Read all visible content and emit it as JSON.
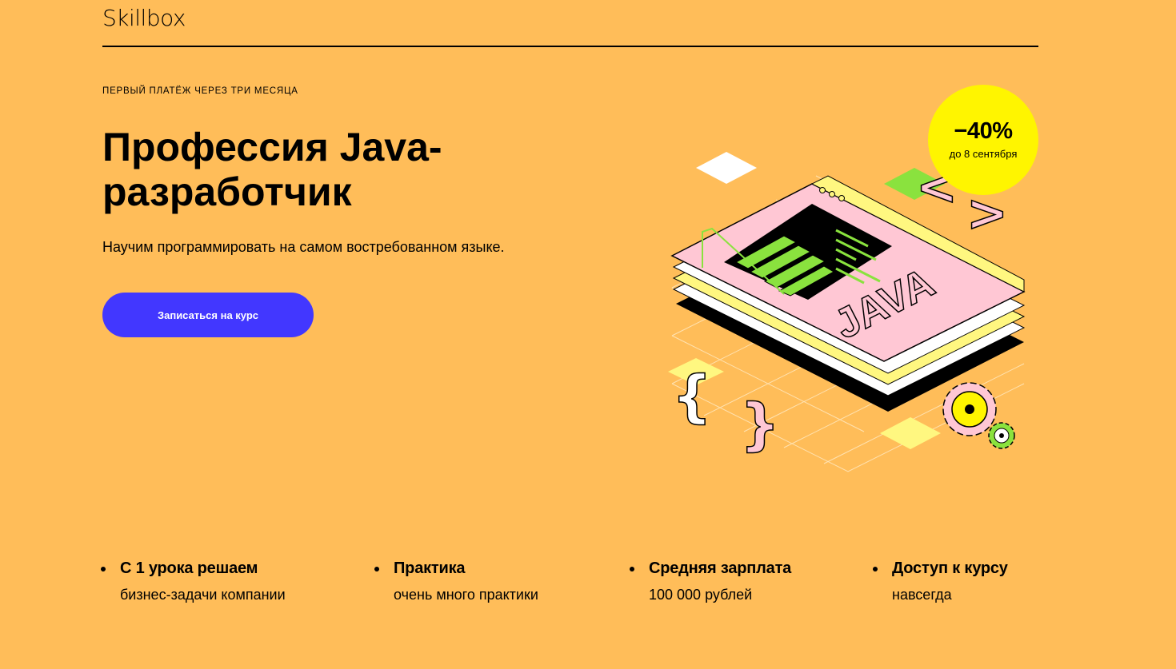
{
  "header": {
    "logo": "Skillbox"
  },
  "hero": {
    "eyebrow": "ПЕРВЫЙ ПЛАТЁЖ ЧЕРЕЗ ТРИ МЕСЯЦА",
    "title": "Профессия Java-разработчик",
    "subtitle": "Научим программировать на самом востребованном языке.",
    "cta_label": "Записаться на курс"
  },
  "badge": {
    "value": "−40%",
    "note": "до 8 сентября"
  },
  "illustration": {
    "word": "JAVA"
  },
  "features": [
    {
      "title": "С 1 урока решаем",
      "subtitle": "бизнес-задачи компании"
    },
    {
      "title": "Практика",
      "subtitle": "очень много практики"
    },
    {
      "title": "Средняя зарплата",
      "subtitle": "100 000 рублей"
    },
    {
      "title": "Доступ к курсу",
      "subtitle": "навсегда"
    }
  ],
  "colors": {
    "background": "#ffbd59",
    "accent": "#4237ff",
    "badge": "#fff500",
    "illustration_pink": "#ffc7d4",
    "illustration_green": "#8ae23e"
  }
}
